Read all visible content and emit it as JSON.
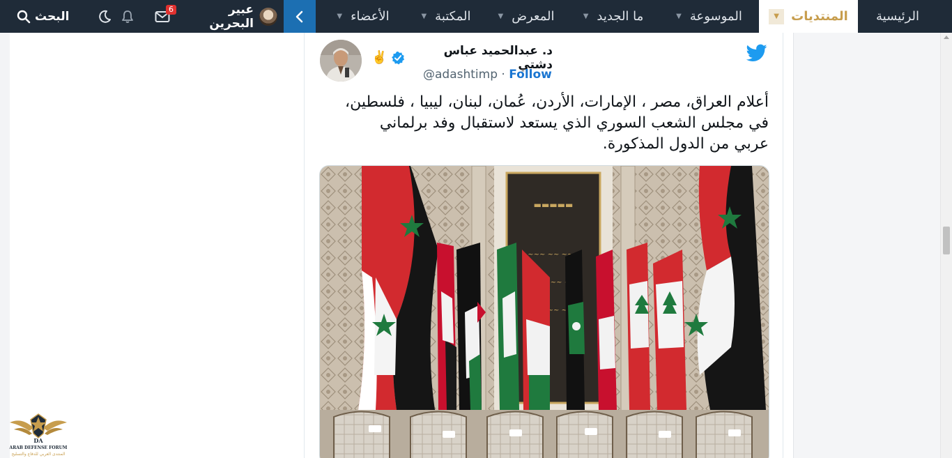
{
  "nav": {
    "home": "الرئيسية",
    "forums": "المنتديات",
    "encyclopedia": "الموسوعة",
    "whats_new": "ما الجديد",
    "gallery": "المعرض",
    "library": "المكتبة",
    "members": "الأعضاء",
    "username": "عبير البحرين",
    "inbox_badge": "6",
    "search": "البحث"
  },
  "tweet": {
    "author_name": "د. عبدالحميد عباس دشتي",
    "author_emoji": "✌️",
    "handle": "@adashtimp",
    "separator": "·",
    "follow": "Follow",
    "text_line1": "أعلام العراق، مصر ، الإمارات، الأردن، عُمان، لبنان، ليبيا ، فلسطين،",
    "text_line2": "في مجلس الشعب السوري الذي يستعد لاستقبال وفد برلماني",
    "text_line3": "عربي من الدول المذكورة."
  },
  "logo": {
    "monogram": "DA",
    "name": "ARAB DEFENSE FORUM",
    "tagline": "المنتدى العربي للدفاع والتسليح"
  },
  "colors": {
    "navbar": "#1f2b38",
    "accent_gold": "#c79d4d",
    "collapse_blue": "#1c6fb2",
    "twitter_blue": "#1d9bf0",
    "badge_red": "#e0312f"
  }
}
